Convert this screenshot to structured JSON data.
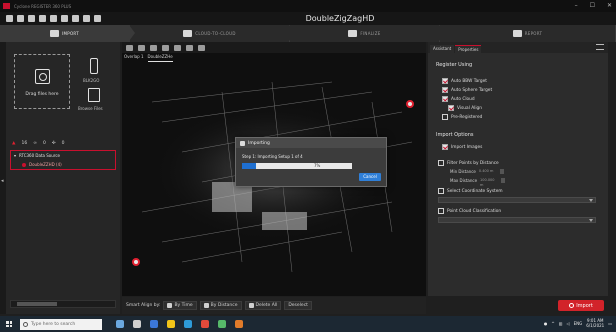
{
  "window": {
    "title": "Cyclone REGISTER 360 PLUS",
    "controls": [
      "–",
      "☐",
      "✕"
    ]
  },
  "project": {
    "name": "DoubleZigZagHD"
  },
  "steps": [
    {
      "label": "IMPORT",
      "icon": "import-icon",
      "active": true
    },
    {
      "label": "CLOUD-TO-CLOUD",
      "icon": "cloud-icon",
      "active": false
    },
    {
      "label": "FINALIZE",
      "icon": "finalize-icon",
      "active": false
    },
    {
      "label": "REPORT",
      "icon": "report-icon",
      "active": false
    }
  ],
  "left": {
    "drop_label": "Drag files here",
    "device_label": "BLK2GO",
    "browse_label": "Browse Files",
    "toolbar": [
      "16",
      "0",
      "0"
    ],
    "tree": {
      "root": "RTC360 Data Source",
      "child": "DoubleZZHD (4)"
    }
  },
  "viewer": {
    "tabs": [
      "Overlap 1",
      "DoubleZZHe"
    ]
  },
  "dialog": {
    "title": "Importing",
    "message": "Step 1: Importing Setup 1 of 4",
    "progress_pct": 0.13,
    "progress_text": "7%",
    "cancel_label": "Cancel"
  },
  "alignbar": {
    "label": "Smart Align by:",
    "buttons": [
      "By Time",
      "By Distance",
      "Delete All",
      "Deselect"
    ]
  },
  "right": {
    "tabs": [
      "Assistant",
      "Properties"
    ],
    "register": {
      "title": "Register Using",
      "options": [
        {
          "label": "Auto BBW Target",
          "checked": true
        },
        {
          "label": "Auto Sphere Target",
          "checked": true
        },
        {
          "label": "Auto Cloud",
          "checked": true
        },
        {
          "label": "Visual Align",
          "checked": true
        },
        {
          "label": "Pre-Registered",
          "checked": false
        }
      ]
    },
    "import": {
      "title": "Import Options",
      "import_images": {
        "label": "Import Images",
        "checked": true
      },
      "filter": {
        "label": "Filter Points by Distance",
        "checked": false
      },
      "min_label": "Min Distance",
      "min_value": "0.400 m",
      "max_label": "Max Distance",
      "max_value": "100.000 m",
      "coord": {
        "label": "Select Coordinate System",
        "checked": false
      },
      "classify": {
        "label": "Point Cloud Classification",
        "checked": false
      }
    }
  },
  "import_button": "Import",
  "taskbar": {
    "search_placeholder": "Type here to search",
    "clock_time": "9:01 AM",
    "clock_date": "6/1/2021",
    "lang": "ENG"
  },
  "colors": {
    "accent": "#c8102e",
    "progress": "#1f6fd0",
    "import_button": "#d2232a"
  }
}
